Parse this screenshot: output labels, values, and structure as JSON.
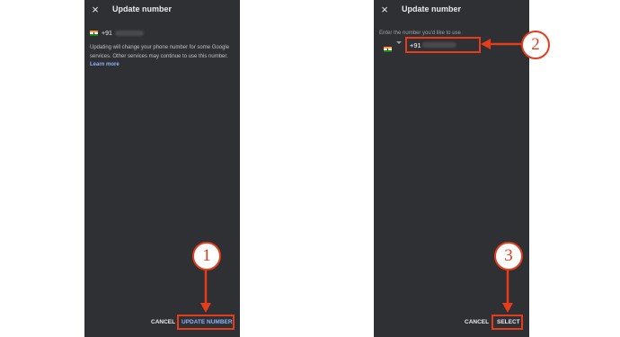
{
  "left_screen": {
    "title": "Update number",
    "close_icon": "×",
    "current_number_code": "+91",
    "info_text": "Updating will change your phone number for some Google services. Other services may continue to use this number.",
    "learn_more_label": "Learn more",
    "cancel_label": "CANCEL",
    "update_label": "UPDATE NUMBER"
  },
  "right_screen": {
    "title": "Update number",
    "close_icon": "×",
    "prompt": "Enter the number you'd like to use",
    "input_value": "+91",
    "cancel_label": "CANCEL",
    "select_label": "SELECT"
  },
  "markers": {
    "step1": "1",
    "step2": "2",
    "step3": "3"
  },
  "colors": {
    "highlight": "#e53c1b",
    "screen_bg": "#2f3033",
    "link": "#8ab4f8"
  },
  "icons": [
    "close-icon",
    "india-flag-icon",
    "dropdown-arrow-icon",
    "arrow-icon"
  ]
}
